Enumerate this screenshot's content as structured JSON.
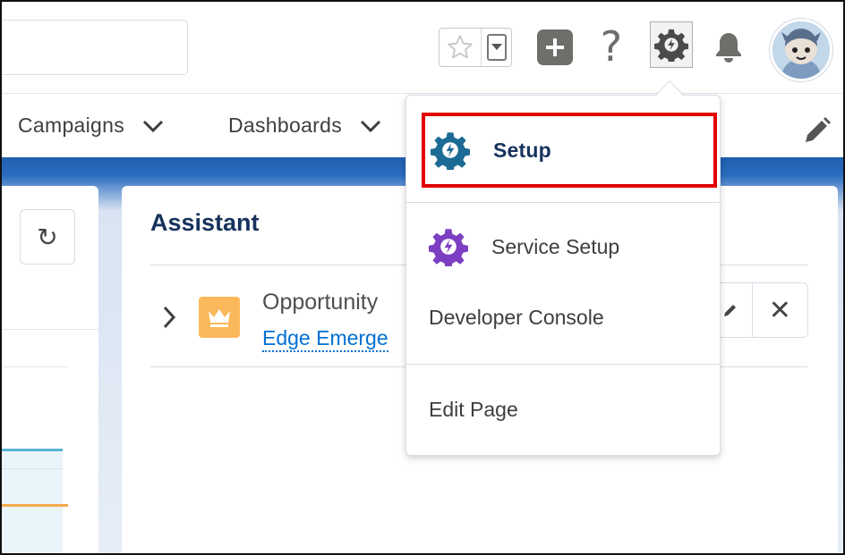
{
  "header": {
    "favorites_star": "star-outline-icon",
    "favorites_dropdown": "chevron-down-icon",
    "help_glyph": "?",
    "colors": {
      "icon_gray": "#706e6b",
      "gear_active_bg": "#f3f2f2"
    }
  },
  "nav": {
    "items": [
      {
        "label": "Campaigns"
      },
      {
        "label": "Dashboards"
      }
    ]
  },
  "assistant": {
    "title": "Assistant",
    "item": {
      "title": "Opportunity",
      "link": "Edge Emerge"
    }
  },
  "setup_menu": {
    "items": [
      {
        "label": "Setup",
        "highlighted": true,
        "icon": "setup-gear-icon",
        "icon_color": "#1b6b94"
      },
      {
        "label": "Service Setup",
        "icon": "service-setup-gear-icon",
        "icon_color": "#7d3fc2"
      },
      {
        "label": "Developer Console"
      },
      {
        "label": "Edit Page"
      }
    ],
    "highlight_color": "#e00000"
  }
}
